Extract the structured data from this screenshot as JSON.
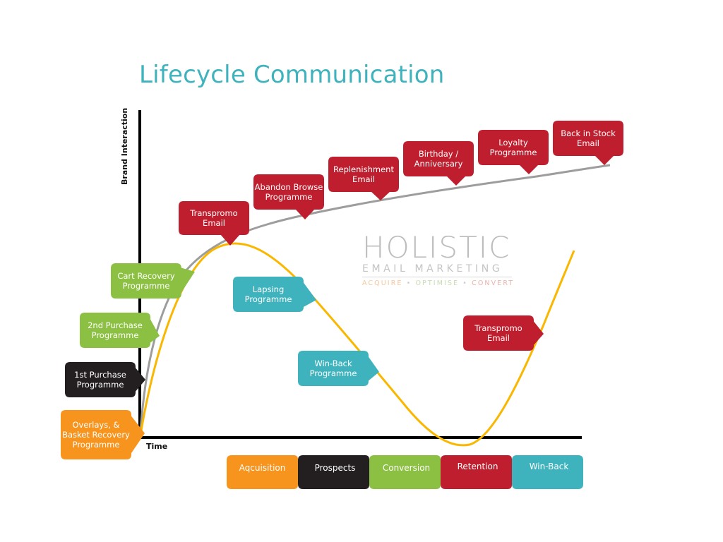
{
  "title": "Lifecycle Communication",
  "axes": {
    "y_label": "Brand Interaction",
    "x_label": "Time"
  },
  "colors": {
    "title": "#3fb3bd",
    "red": "#be1e2d",
    "green": "#8cc043",
    "black": "#231f20",
    "orange": "#f7941d",
    "teal": "#3fb3bd",
    "gray_curve": "#9d9d9d",
    "yellow_curve": "#f9b700",
    "axis": "#000000"
  },
  "logo": {
    "name": "HOLISTIC",
    "subtitle": "EMAIL MARKETING",
    "tagline": [
      "ACQUIRE",
      "OPTIMISE",
      "CONVERT"
    ],
    "separator": "•"
  },
  "curves": {
    "engagement": {
      "name": "brand-engagement-curve",
      "color": "gray",
      "shape": "logarithmic-rise"
    },
    "lifecycle": {
      "name": "customer-lifecycle-curve",
      "color": "yellow",
      "shape": "rise-fall-rise"
    }
  },
  "callouts": [
    {
      "id": "overlays",
      "lines": [
        "Overlays, &",
        "Basket Recovery",
        "Programme"
      ],
      "color": "orange",
      "pointer": "right"
    },
    {
      "id": "first-purchase",
      "lines": [
        "1st Purchase",
        "Programme"
      ],
      "color": "black",
      "pointer": "right"
    },
    {
      "id": "second-purchase",
      "lines": [
        "2nd Purchase",
        "Programme"
      ],
      "color": "green",
      "pointer": "right"
    },
    {
      "id": "cart-recovery",
      "lines": [
        "Cart Recovery",
        "Programme"
      ],
      "color": "green",
      "pointer": "right"
    },
    {
      "id": "transpromo-1",
      "lines": [
        "Transpromo",
        "Email"
      ],
      "color": "red",
      "pointer": "down"
    },
    {
      "id": "abandon-browse",
      "lines": [
        "Abandon Browse",
        "Programme"
      ],
      "color": "red",
      "pointer": "down"
    },
    {
      "id": "replenishment",
      "lines": [
        "Replenishment",
        "Email"
      ],
      "color": "red",
      "pointer": "down"
    },
    {
      "id": "birthday",
      "lines": [
        "Birthday /",
        "Anniversary"
      ],
      "color": "red",
      "pointer": "down"
    },
    {
      "id": "loyalty",
      "lines": [
        "Loyalty",
        "Programme"
      ],
      "color": "red",
      "pointer": "down"
    },
    {
      "id": "back-in-stock",
      "lines": [
        "Back in Stock",
        "Email"
      ],
      "color": "red",
      "pointer": "down"
    },
    {
      "id": "lapsing",
      "lines": [
        "Lapsing",
        "Programme"
      ],
      "color": "teal",
      "pointer": "right"
    },
    {
      "id": "win-back",
      "lines": [
        "Win-Back",
        "Programme"
      ],
      "color": "teal",
      "pointer": "right"
    },
    {
      "id": "transpromo-2",
      "lines": [
        "Transpromo",
        "Email"
      ],
      "color": "red",
      "pointer": "right"
    }
  ],
  "stages": [
    {
      "label": "Aqcuisition",
      "color": "orange"
    },
    {
      "label": "Prospects",
      "color": "black"
    },
    {
      "label": "Conversion",
      "color": "green"
    },
    {
      "label": "Retention",
      "color": "red"
    },
    {
      "label": "Win-Back",
      "color": "teal"
    }
  ]
}
